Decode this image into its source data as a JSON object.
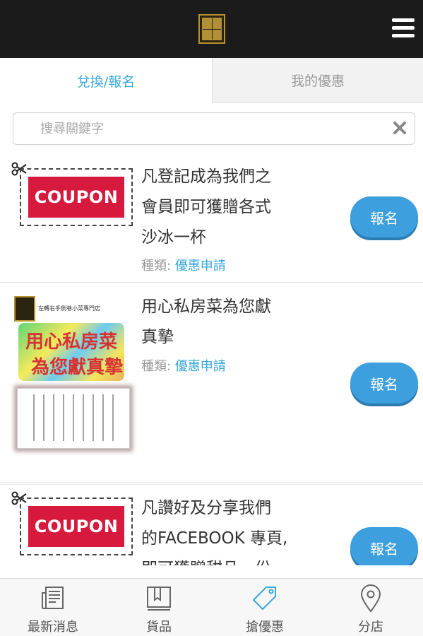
{
  "header": {
    "logo": "store-logo",
    "menu_icon": "hamburger-icon"
  },
  "tabs": [
    {
      "label": "兌換/報名",
      "active": true
    },
    {
      "label": "我的優惠",
      "active": false
    }
  ],
  "search": {
    "placeholder": "搜尋關鍵字",
    "value": ""
  },
  "coupons": [
    {
      "image_label": "COUPON",
      "title_lines": [
        "凡登記成為我們之",
        "會員即可獲贈各式",
        "沙冰一杯"
      ],
      "meta_label": "種類:",
      "category": "優惠申請",
      "button": "報名"
    },
    {
      "image_caption": "左轉右手側巷小菜專門店",
      "image_calligraphy": [
        "用心私房菜",
        "為您獻真摯"
      ],
      "title_lines": [
        "用心私房菜為您獻",
        "真摯"
      ],
      "meta_label": "種類:",
      "category": "優惠申請",
      "button": "報名"
    },
    {
      "image_label": "COUPON",
      "title_lines": [
        "凡讚好及分享我們",
        "的FACEBOOK 專頁,",
        "即可獲贈甜品一份"
      ],
      "button": "報名"
    }
  ],
  "bottom_nav": [
    {
      "label": "最新消息",
      "icon": "newspaper-icon"
    },
    {
      "label": "貨品",
      "icon": "book-icon"
    },
    {
      "label": "搶優惠",
      "icon": "tag-icon",
      "active": true
    },
    {
      "label": "分店",
      "icon": "map-pin-icon"
    }
  ],
  "colors": {
    "accent": "#3aa7d8",
    "button": "#3d9fde",
    "coupon": "#d7193e",
    "header": "#1b1b1b"
  }
}
